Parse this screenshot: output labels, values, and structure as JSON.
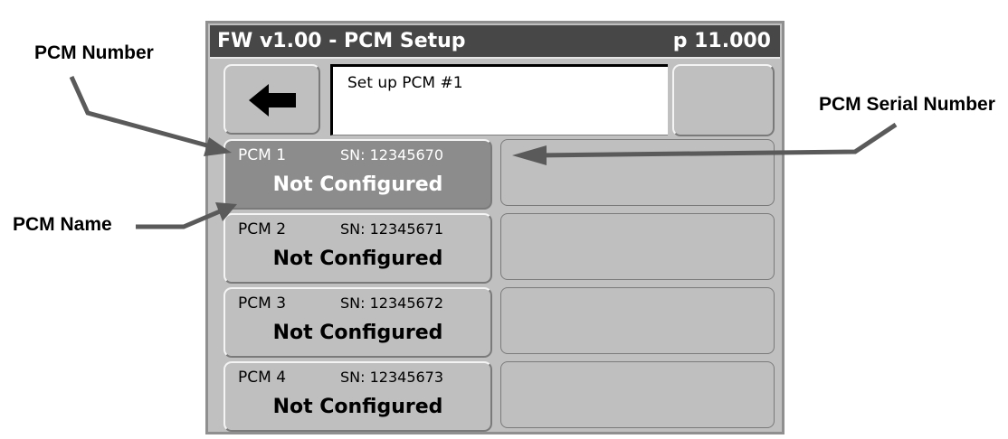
{
  "callouts": {
    "pcm_number": "PCM Number",
    "pcm_name": "PCM Name",
    "pcm_serial": "PCM Serial Number"
  },
  "screen": {
    "title": "FW v1.00 - PCM Setup",
    "page": "p 11.000",
    "message": "Set up PCM #1",
    "back_icon": "left-arrow-icon",
    "pcms": [
      {
        "number": "PCM 1",
        "sn": "SN: 12345670",
        "name": "Not Configured",
        "selected": true
      },
      {
        "number": "PCM 2",
        "sn": "SN: 12345671",
        "name": "Not Configured",
        "selected": false
      },
      {
        "number": "PCM 3",
        "sn": "SN: 12345672",
        "name": "Not Configured",
        "selected": false
      },
      {
        "number": "PCM 4",
        "sn": "SN: 12345673",
        "name": "Not Configured",
        "selected": false
      }
    ]
  },
  "colors": {
    "title_bar": "#474747",
    "panel": "#c0c0c0",
    "selected": "#8c8c8c",
    "arrow": "#5a5a5a"
  }
}
